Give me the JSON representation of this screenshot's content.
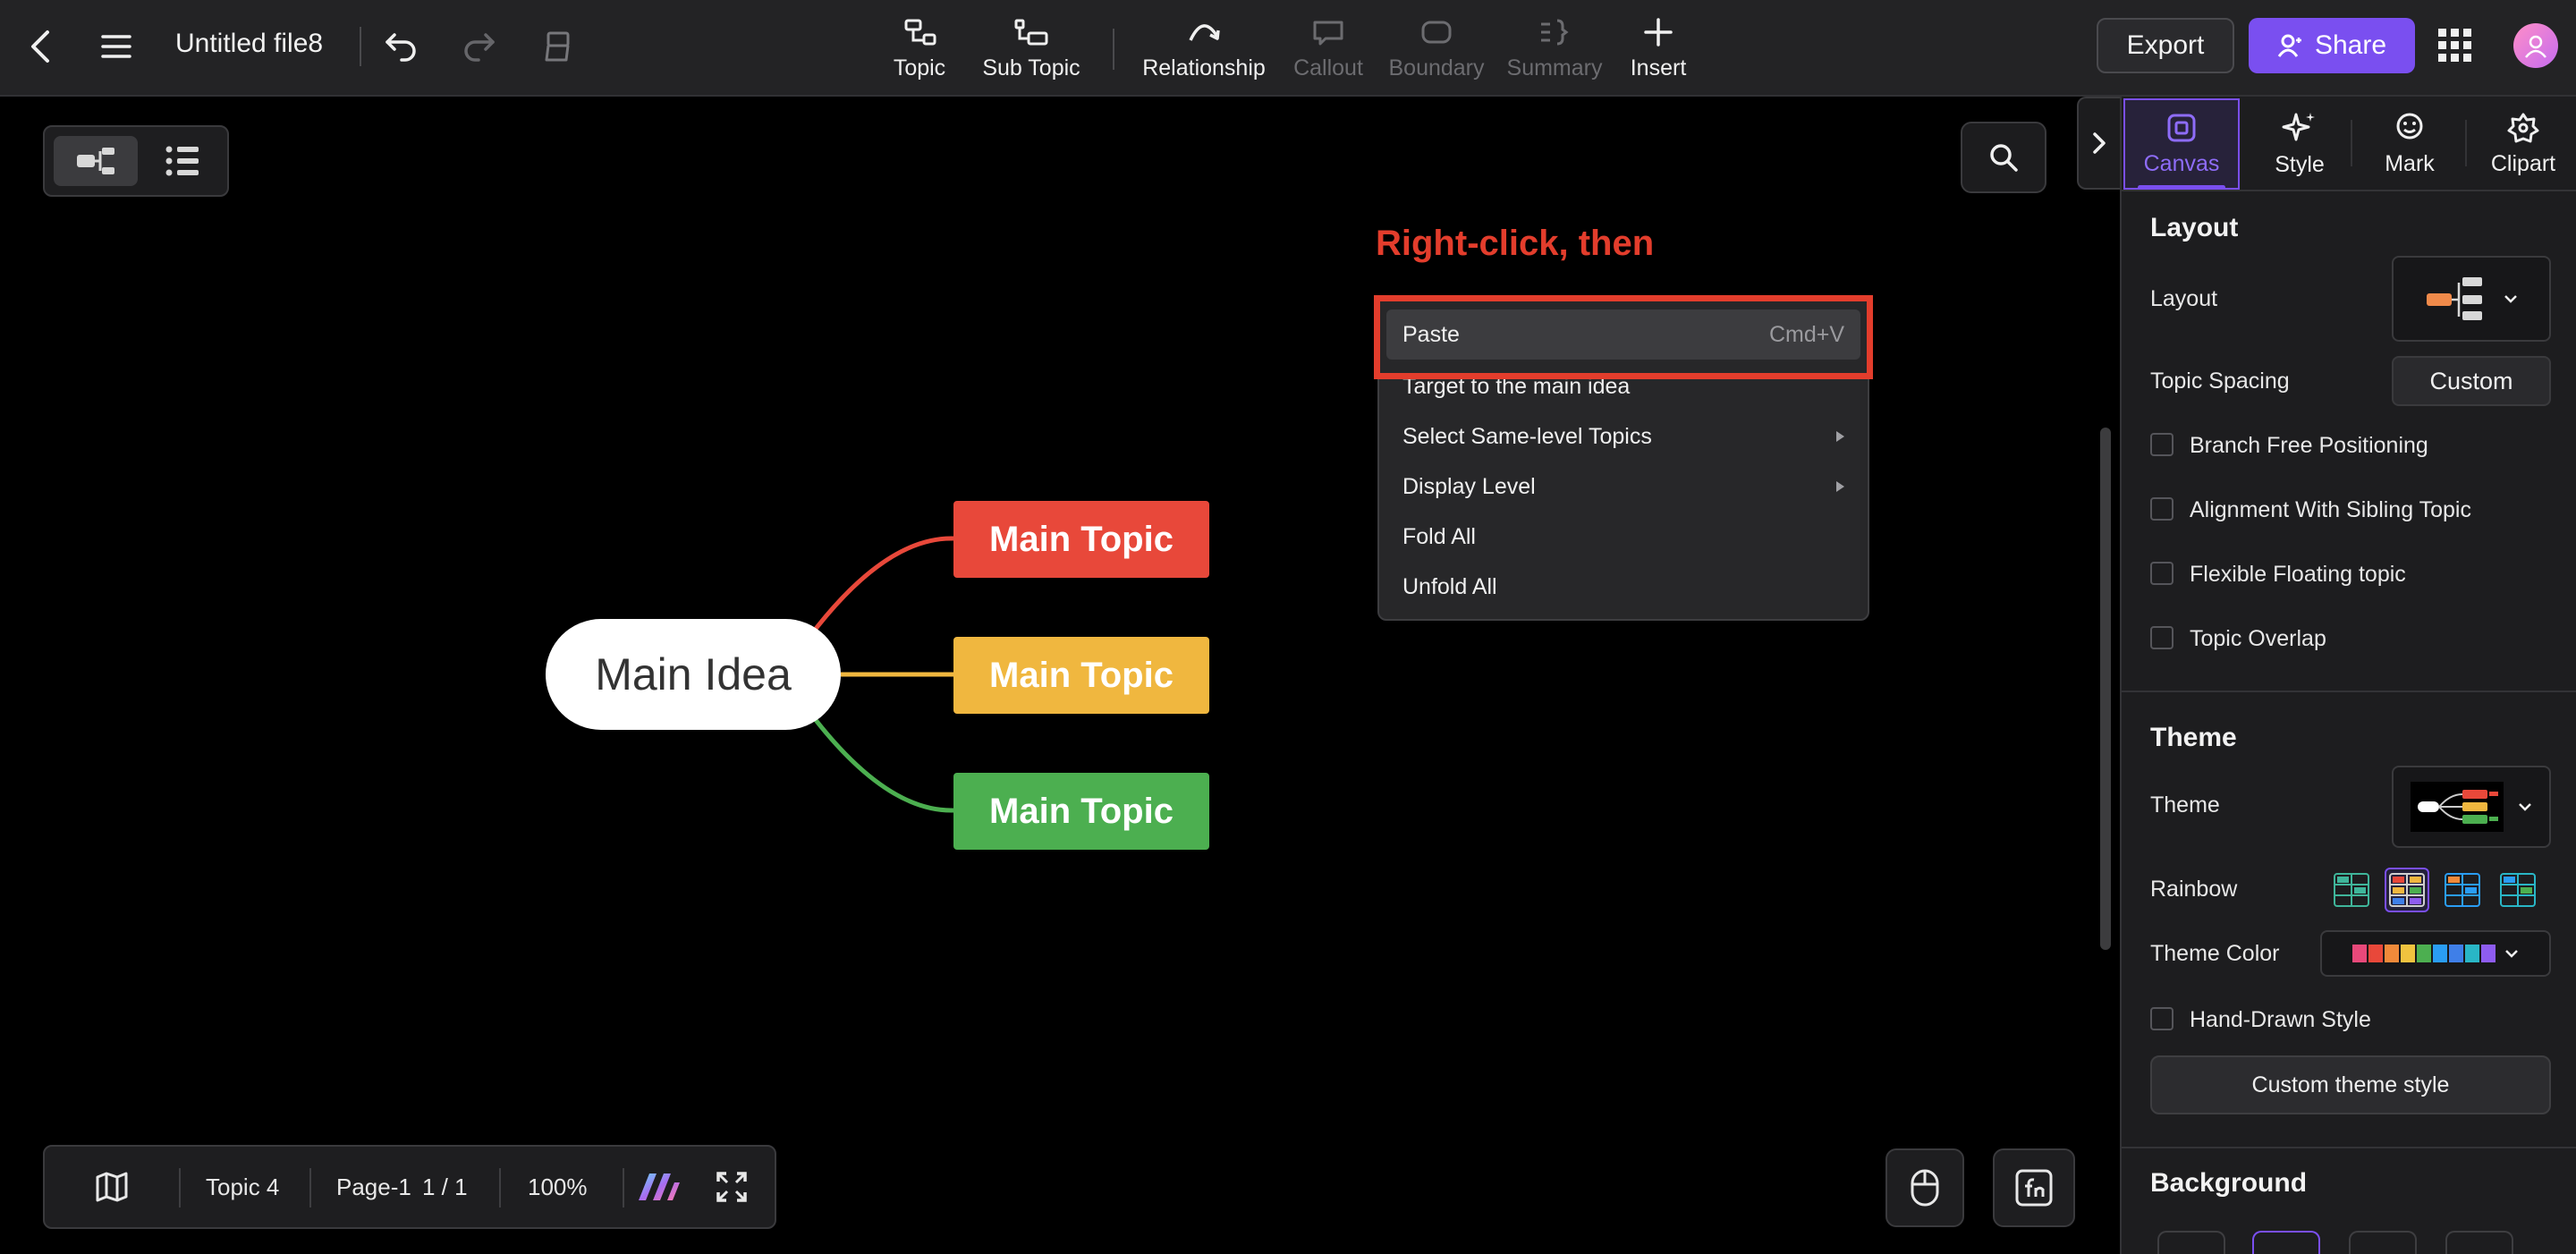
{
  "topbar": {
    "file_title": "Untitled file8",
    "tools": [
      {
        "label": "Topic",
        "enabled": true
      },
      {
        "label": "Sub Topic",
        "enabled": true
      },
      {
        "label": "Relationship",
        "enabled": true
      },
      {
        "label": "Callout",
        "enabled": false
      },
      {
        "label": "Boundary",
        "enabled": false
      },
      {
        "label": "Summary",
        "enabled": false
      },
      {
        "label": "Insert",
        "enabled": true
      }
    ],
    "export_label": "Export",
    "share_label": "Share"
  },
  "mindmap": {
    "main_idea": "Main Idea",
    "topics": [
      {
        "label": "Main Topic",
        "color": "#e8483a"
      },
      {
        "label": "Main Topic",
        "color": "#f0b73f"
      },
      {
        "label": "Main Topic",
        "color": "#4caf50"
      }
    ]
  },
  "annotation": {
    "hint": "Right-click, then",
    "highlight_color": "#e33d2c"
  },
  "context_menu": {
    "items": [
      {
        "label": "Paste",
        "shortcut": "Cmd+V",
        "highlighted": true
      },
      {
        "label": "Target to the main idea"
      },
      {
        "label": "Select Same-level Topics",
        "submenu": true
      },
      {
        "label": "Display Level",
        "submenu": true
      },
      {
        "label": "Fold All"
      },
      {
        "label": "Unfold All"
      }
    ]
  },
  "bottom_bar": {
    "topic_count": "Topic 4",
    "page_label": "Page-1",
    "page_count": "1 / 1",
    "zoom": "100%"
  },
  "panel": {
    "tabs": [
      {
        "label": "Canvas",
        "active": true
      },
      {
        "label": "Style"
      },
      {
        "label": "Mark"
      },
      {
        "label": "Clipart"
      }
    ],
    "layout_section": {
      "title": "Layout",
      "layout_label": "Layout",
      "spacing_label": "Topic Spacing",
      "spacing_value": "Custom",
      "options": [
        {
          "label": "Branch Free Positioning",
          "checked": false
        },
        {
          "label": "Alignment With Sibling Topic",
          "checked": false
        },
        {
          "label": "Flexible Floating topic",
          "checked": false
        },
        {
          "label": "Topic Overlap",
          "checked": false
        }
      ]
    },
    "theme_section": {
      "title": "Theme",
      "theme_label": "Theme",
      "rainbow_label": "Rainbow",
      "theme_color_label": "Theme Color",
      "theme_colors": [
        "#e8497a",
        "#e8483a",
        "#f08a3a",
        "#f0c33f",
        "#4caf50",
        "#2a9df4",
        "#3f7fe8",
        "#29b6c6",
        "#8e5cf0"
      ],
      "hand_drawn_label": "Hand-Drawn Style",
      "custom_theme_label": "Custom theme style"
    },
    "background_section": {
      "title": "Background"
    }
  },
  "colors": {
    "accent": "#7a4ff0",
    "topbar_bg": "#232325",
    "panel_bg": "#1d1d1f"
  }
}
